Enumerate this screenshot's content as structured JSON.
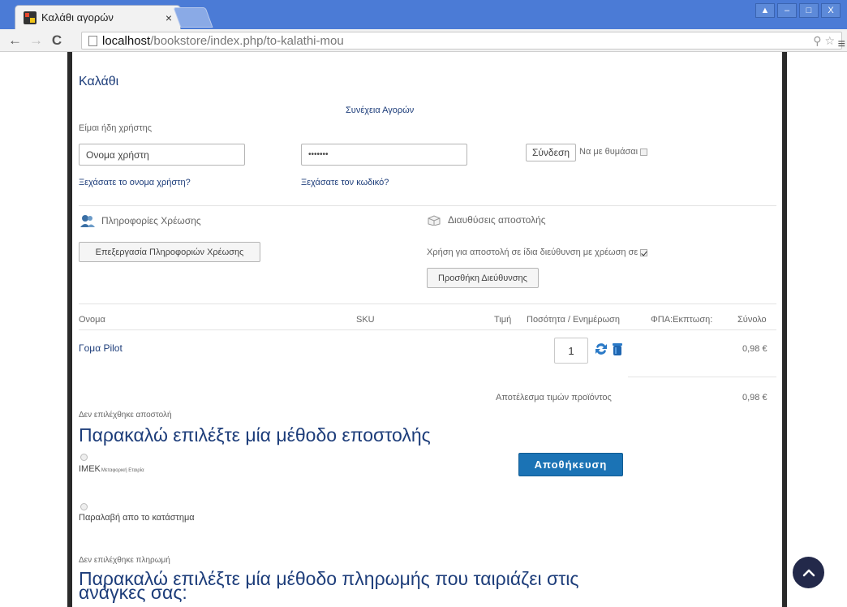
{
  "browser": {
    "tab_title": "Καλάθι αγορών",
    "tab_close": "×",
    "url_host": "localhost",
    "url_path": "/bookstore/index.php/to-kalathi-mou",
    "window_buttons": [
      "▲",
      "–",
      "□",
      "X"
    ]
  },
  "cart": {
    "title": "Καλάθι",
    "continue_shopping": "Συνέχεια Αγορών",
    "already_user": "Είμαι ήδη χρήστης",
    "username_value": "Ονομα χρήστη",
    "password_value": "•••••••",
    "login_button": "Σύνδεση",
    "remember_me": "Να με θυμάσαι",
    "forgot_username": "Ξεχάσατε το ονομα χρήστη?",
    "forgot_password": "Ξεχάσατε τον κωδικό?"
  },
  "billing": {
    "title": "Πληροφορίες Χρέωσης",
    "edit_button": "Επεξεργασία Πληροφοριών Χρέωσης"
  },
  "shipping_address": {
    "title": "Διαυθύσεις αποστολής",
    "same_as_billing": "Χρήση για αποστολή σε ίδια διεύθυνση με χρέωση σε",
    "add_address_button": "Προσθήκη Διεύθυνσης"
  },
  "table": {
    "headers": {
      "name": "Ονομα",
      "sku": "SKU",
      "price": "Τιμή",
      "quantity": "Ποσότητα / Ενημέρωση",
      "tax": "ΦΠΑ:Εκπτωση:",
      "total": "Σύνολο"
    },
    "rows": [
      {
        "name": "Γομα Pilot",
        "sku": "",
        "price": "",
        "quantity": "1",
        "total": "0,98 €"
      }
    ],
    "product_subtotal_label": "Αποτέλεσμα τιμών προϊόντος",
    "product_subtotal_value": "0,98 €"
  },
  "shipment": {
    "none_selected": "Δεν επιλέχθηκε αποστολή",
    "prompt": "Παρακαλώ επιλέξτε μία μέθοδο εποστολής",
    "options": [
      {
        "name": "ΙΜΕΚ",
        "subtitle": "Μεταφορική Εταιρία"
      },
      {
        "name": "Παραλαβή απο το κατάστημα",
        "subtitle": ""
      }
    ],
    "save_button": "Αποθήκευση"
  },
  "payment": {
    "none_selected": "Δεν επιλέχθηκε πληρωμή",
    "prompt": "Παρακαλώ επιλέξτε μία μέθοδο πληρωμής που ταιριάζει στις ανάγκες σας:"
  },
  "colors": {
    "link": "#1d3d7a",
    "primary": "#1b73b5",
    "scroll_top": "#23294a"
  }
}
